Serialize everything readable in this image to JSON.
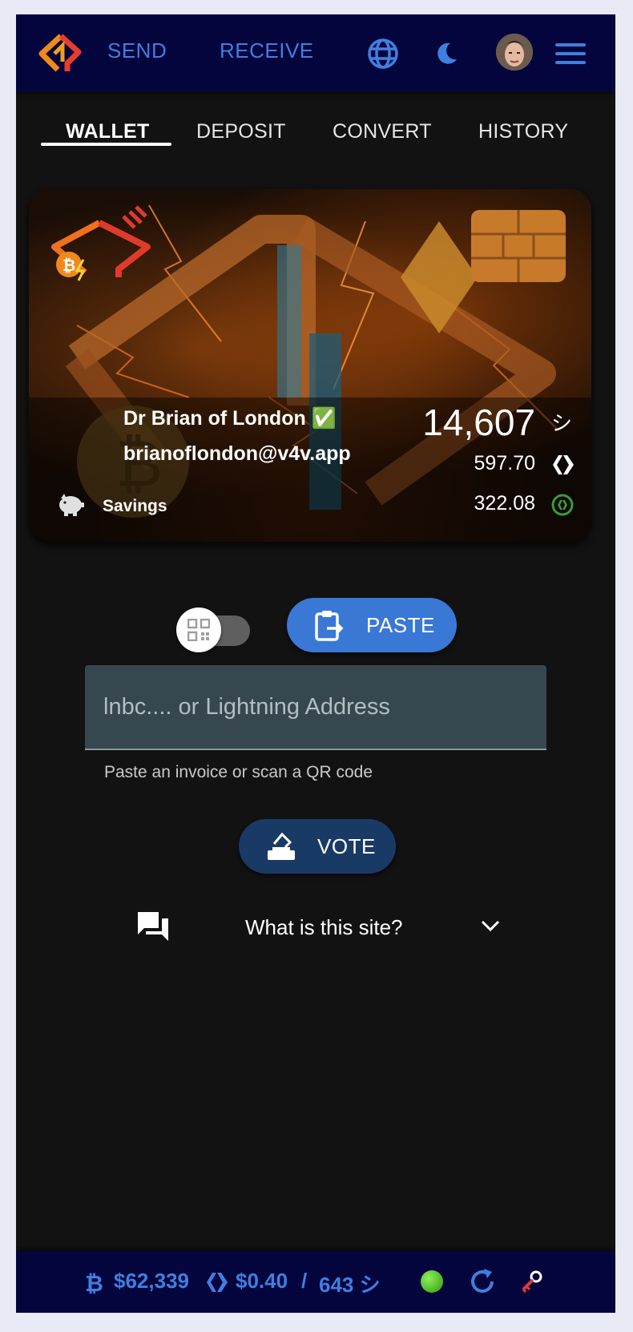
{
  "topbar": {
    "send_label": "SEND",
    "receive_label": "RECEIVE"
  },
  "tabs": [
    {
      "label": "WALLET",
      "active": true
    },
    {
      "label": "DEPOSIT",
      "active": false
    },
    {
      "label": "CONVERT",
      "active": false
    },
    {
      "label": "HISTORY",
      "active": false
    }
  ],
  "card": {
    "name": "Dr Brian of London ✅",
    "address": "brianoflondon@v4v.app",
    "savings_label": "Savings",
    "sats_balance": "14,607",
    "sats_unit": "シ",
    "hive_balance": "597.70",
    "hbd_balance": "322.08"
  },
  "controls": {
    "paste_label": "PASTE",
    "input_placeholder": "lnbc.... or Lightning Address",
    "input_value": "",
    "hint": "Paste an invoice or scan a QR code",
    "vote_label": "VOTE",
    "faq_title": "What is this site?"
  },
  "bottombar": {
    "btc_price": "$62,339",
    "hive_price": "$0.40",
    "separator": "/",
    "sats_per_hive": "643 シ"
  },
  "colors": {
    "accent": "#3f7fe0",
    "topbar_bg": "#05053d",
    "paste_bg": "#3a78d6",
    "vote_bg": "#1a3a66",
    "status_dot": "#4cc41c"
  },
  "icons": {
    "globe": "globe-icon",
    "theme": "moon-icon",
    "menu": "hamburger-menu-icon",
    "qr": "qr-code-icon",
    "paste": "clipboard-icon",
    "vote": "ballot-box-icon",
    "faq": "chat-bubbles-icon",
    "expand": "chevron-down-icon",
    "refresh": "refresh-icon",
    "key": "key-icon"
  }
}
